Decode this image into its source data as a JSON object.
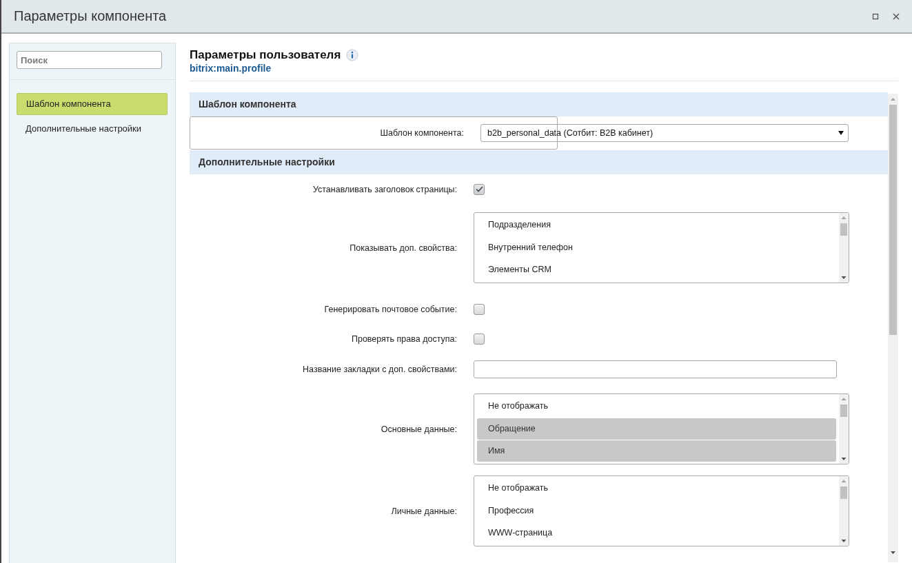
{
  "window": {
    "title": "Параметры компонента"
  },
  "sidebar": {
    "search": {
      "placeholder": "Поиск"
    },
    "items": [
      {
        "label": "Шаблон компонента",
        "selected": true
      },
      {
        "label": "Дополнительные настройки",
        "selected": false
      }
    ]
  },
  "header": {
    "title": "Параметры пользователя",
    "code": "bitrix:main.profile"
  },
  "sections": [
    {
      "title": "Шаблон компонента",
      "rows": [
        {
          "kind": "select",
          "label": "Шаблон компонента:",
          "value": "b2b_personal_data (Сотбит: B2B кабинет)"
        }
      ]
    },
    {
      "title": "Дополнительные настройки",
      "rows": [
        {
          "kind": "checkbox",
          "label": "Устанавливать заголовок страницы:",
          "checked": true
        },
        {
          "kind": "multiselect",
          "label": "Показывать доп. свойства:",
          "options": [
            {
              "label": "Подразделения",
              "selected": false
            },
            {
              "label": "Внутренний телефон",
              "selected": false
            },
            {
              "label": "Элементы CRM",
              "selected": false
            }
          ]
        },
        {
          "kind": "checkbox",
          "label": "Генерировать почтовое событие:",
          "checked": false
        },
        {
          "kind": "checkbox",
          "label": "Проверять права доступа:",
          "checked": false
        },
        {
          "kind": "text",
          "label": "Название закладки с доп. свойствами:",
          "value": ""
        },
        {
          "kind": "multiselect",
          "label": "Основные данные:",
          "options": [
            {
              "label": "Не отображать",
              "selected": false
            },
            {
              "label": "Обращение",
              "selected": true
            },
            {
              "label": "Имя",
              "selected": true
            }
          ]
        },
        {
          "kind": "multiselect",
          "label": "Личные данные:",
          "options": [
            {
              "label": "Не отображать",
              "selected": false
            },
            {
              "label": "Профессия",
              "selected": false
            },
            {
              "label": "WWW-страница",
              "selected": false
            }
          ]
        }
      ]
    }
  ]
}
